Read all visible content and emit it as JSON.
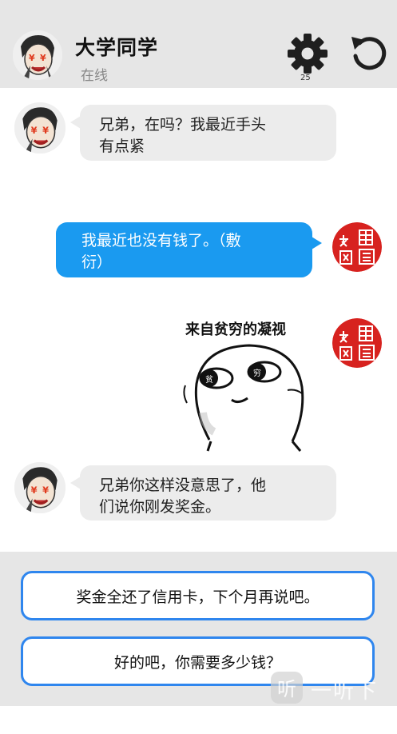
{
  "header": {
    "contact_name": "大学同学",
    "status": "在线",
    "settings_badge": "25"
  },
  "messages": [
    {
      "from": "friend",
      "text_line1": "兄弟，在吗？我最近手头",
      "text_line2": "有点紧"
    },
    {
      "from": "me",
      "text_line1": "我最近也没有钱了。（敷",
      "text_line2": "衍）"
    },
    {
      "from": "me",
      "type": "sticker",
      "caption": "来自贫穷的凝视",
      "eye_left": "贫",
      "eye_right": "穷"
    },
    {
      "from": "friend",
      "text_line1": "兄弟你这样没意思了，他",
      "text_line2": "们说你刚发奖金。"
    }
  ],
  "avatars": {
    "friend_mark": "¥¥",
    "me_seal": "大展宏图"
  },
  "options": [
    {
      "label": "奖金全还了信用卡，下个月再说吧。"
    },
    {
      "label": "好的吧，你需要多少钱？"
    }
  ],
  "watermark": {
    "text": "一听下载"
  },
  "colors": {
    "my_bubble": "#1a9af0",
    "friend_bubble": "#ececec",
    "option_border": "#2f86ee",
    "seal_red": "#d7221f"
  }
}
